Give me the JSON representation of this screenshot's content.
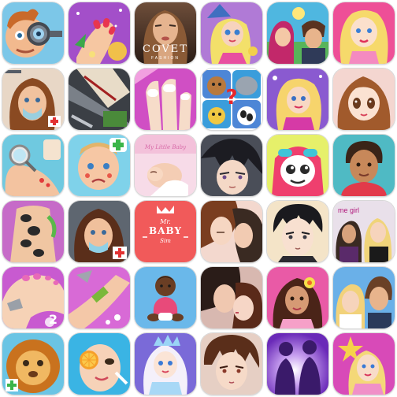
{
  "grid": {
    "title": "",
    "tiles": [
      {
        "row": 0,
        "col": 0,
        "icon": "eye-doctor-app-icon"
      },
      {
        "row": 0,
        "col": 1,
        "icon": "nail-salon-app-icon"
      },
      {
        "row": 0,
        "col": 2,
        "icon": "covet-fashion-app-icon",
        "text": "COVET",
        "subtext": "FASHION"
      },
      {
        "row": 0,
        "col": 3,
        "icon": "dress-up-girl-app-icon"
      },
      {
        "row": 0,
        "col": 4,
        "icon": "couple-story-app-icon"
      },
      {
        "row": 0,
        "col": 5,
        "icon": "blonde-princess-app-icon"
      },
      {
        "row": 1,
        "col": 0,
        "icon": "hospital-girl-app-icon"
      },
      {
        "row": 1,
        "col": 1,
        "icon": "arm-surgery-app-icon"
      },
      {
        "row": 1,
        "col": 2,
        "icon": "manicure-app-icon"
      },
      {
        "row": 1,
        "col": 3,
        "icon": "animal-quiz-app-icon",
        "text": "?"
      },
      {
        "row": 1,
        "col": 4,
        "icon": "pop-star-app-icon"
      },
      {
        "row": 1,
        "col": 5,
        "icon": "anime-girl-app-icon"
      },
      {
        "row": 2,
        "col": 0,
        "icon": "foot-doctor-app-icon"
      },
      {
        "row": 2,
        "col": 1,
        "icon": "baby-doctor-app-icon"
      },
      {
        "row": 2,
        "col": 2,
        "icon": "my-little-baby-app-icon",
        "text": "My Little Baby"
      },
      {
        "row": 2,
        "col": 3,
        "icon": "anime-boy-app-icon"
      },
      {
        "row": 2,
        "col": 4,
        "icon": "monster-pet-app-icon"
      },
      {
        "row": 2,
        "col": 5,
        "icon": "avatar-boy-app-icon"
      },
      {
        "row": 3,
        "col": 0,
        "icon": "spa-massage-app-icon"
      },
      {
        "row": 3,
        "col": 1,
        "icon": "emergency-girl-app-icon"
      },
      {
        "row": 3,
        "col": 2,
        "icon": "mr-baby-sim-app-icon",
        "text_mr": "Mr.",
        "text": "BABY",
        "subtext": "Sim"
      },
      {
        "row": 3,
        "col": 3,
        "icon": "romance-story-app-icon"
      },
      {
        "row": 3,
        "col": 4,
        "icon": "anime-guy-app-icon"
      },
      {
        "row": 3,
        "col": 5,
        "icon": "me-girl-app-icon",
        "text": "me girl"
      },
      {
        "row": 4,
        "col": 0,
        "icon": "foot-spa-app-icon",
        "text": "2"
      },
      {
        "row": 4,
        "col": 1,
        "icon": "leg-wax-app-icon"
      },
      {
        "row": 4,
        "col": 2,
        "icon": "baby-sitting-app-icon"
      },
      {
        "row": 4,
        "col": 3,
        "icon": "kiss-romance-app-icon"
      },
      {
        "row": 4,
        "col": 4,
        "icon": "tropical-girl-app-icon"
      },
      {
        "row": 4,
        "col": 5,
        "icon": "high-school-couple-app-icon"
      },
      {
        "row": 5,
        "col": 0,
        "icon": "lion-doctor-app-icon"
      },
      {
        "row": 5,
        "col": 1,
        "icon": "face-mask-app-icon"
      },
      {
        "row": 5,
        "col": 2,
        "icon": "ice-princess-app-icon"
      },
      {
        "row": 5,
        "col": 3,
        "icon": "vampire-romance-app-icon"
      },
      {
        "row": 5,
        "col": 4,
        "icon": "silhouette-dance-app-icon"
      },
      {
        "row": 5,
        "col": 5,
        "icon": "star-girl-app-icon"
      }
    ]
  },
  "colors": {
    "background": "#ffffff",
    "tile_border": "#d8d8d8"
  }
}
